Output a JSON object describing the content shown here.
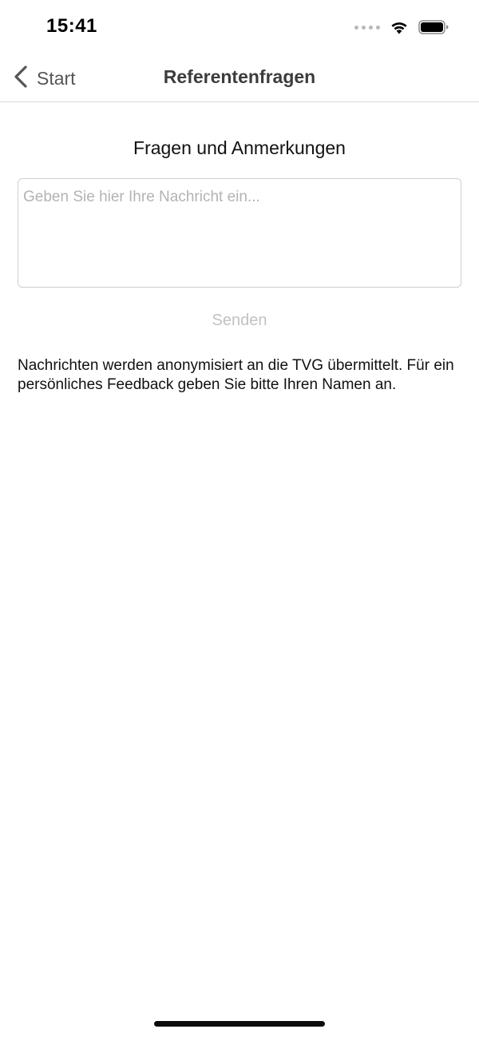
{
  "status_bar": {
    "time": "15:41",
    "icons": [
      "signal-dots-icon",
      "wifi-icon",
      "battery-icon"
    ]
  },
  "nav": {
    "back_label": "Start",
    "back_icon": "chevron-left-icon",
    "title": "Referentenfragen"
  },
  "form": {
    "section_title": "Fragen und Anmerkungen",
    "message_placeholder": "Geben Sie hier Ihre Nachricht ein...",
    "message_value": "",
    "send_label": "Senden"
  },
  "info": {
    "text": "Nachrichten werden anonymisiert an die TVG übermittelt. Für ein persönliches Feedback geben Sie bitte Ihren Namen an."
  },
  "colors": {
    "nav_title": "#3c3c3c",
    "back_label": "#555555",
    "send_disabled": "#c2c2c2",
    "placeholder": "#b3b3b3",
    "field_border": "#cfcfcf"
  }
}
